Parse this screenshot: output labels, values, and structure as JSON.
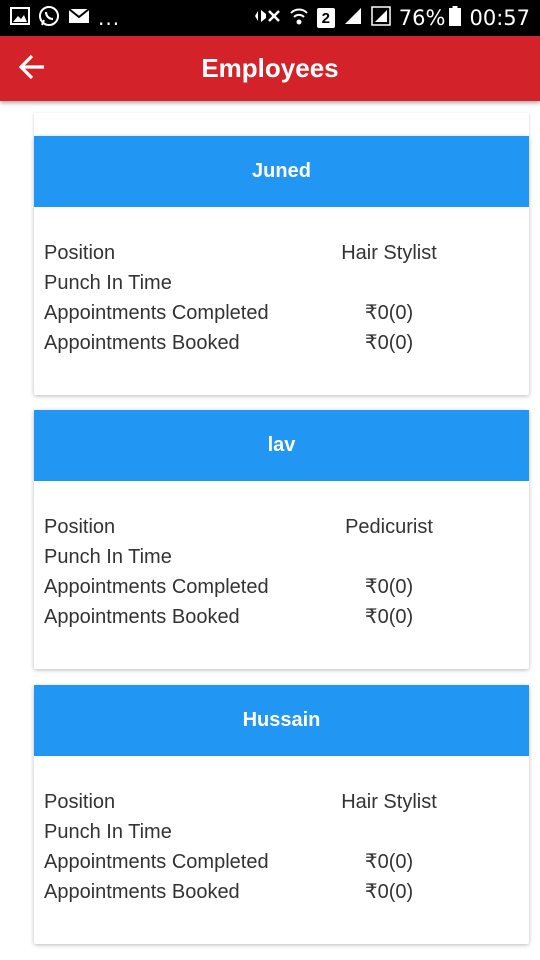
{
  "status_bar": {
    "left_icons": [
      "gallery-icon",
      "whatsapp-icon",
      "mail-icon"
    ],
    "overflow": "...",
    "battery_percent": "76%",
    "sim_badge": "2",
    "time": "00:57"
  },
  "app_bar": {
    "title": "Employees",
    "back_icon": "arrow-left-icon"
  },
  "labels": {
    "position": "Position",
    "punch_in": "Punch In Time",
    "completed": "Appointments Completed",
    "booked": "Appointments Booked"
  },
  "employees": [
    {
      "name": "Juned",
      "position": "Hair Stylist",
      "punch_in": "",
      "completed": "₹0(0)",
      "booked": "₹0(0)"
    },
    {
      "name": "lav",
      "position": "Pedicurist",
      "punch_in": "",
      "completed": "₹0(0)",
      "booked": "₹0(0)"
    },
    {
      "name": "Hussain",
      "position": "Hair Stylist",
      "punch_in": "",
      "completed": "₹0(0)",
      "booked": "₹0(0)"
    }
  ],
  "colors": {
    "app_bar": "#d3222a",
    "card_header": "#2196f3",
    "status_bar": "#000000"
  }
}
